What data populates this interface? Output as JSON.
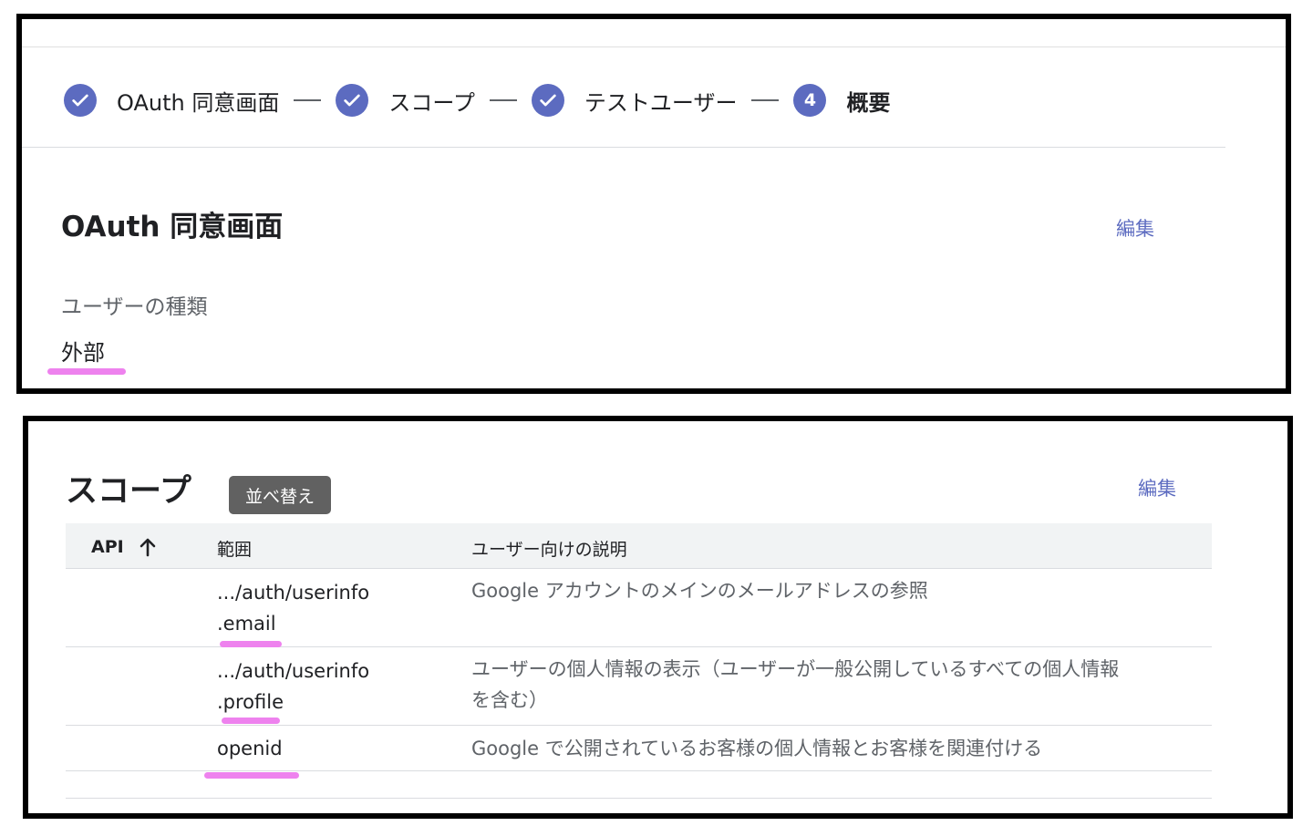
{
  "stepper": {
    "steps": [
      {
        "label": "OAuth 同意画面",
        "state": "done"
      },
      {
        "label": "スコープ",
        "state": "done"
      },
      {
        "label": "テストユーザー",
        "state": "done"
      },
      {
        "label": "概要",
        "state": "active",
        "number": "4"
      }
    ]
  },
  "oauth_section": {
    "title": "OAuth 同意画面",
    "edit_label": "編集",
    "user_type_label": "ユーザーの種類",
    "user_type_value": "外部"
  },
  "scope_section": {
    "title": "スコープ",
    "edit_label": "編集",
    "sort_tooltip": "並べ替え",
    "columns": {
      "api": "API",
      "range": "範囲",
      "description": "ユーザー向けの説明"
    },
    "rows": [
      {
        "range_lines": [
          ".../auth/userinfo",
          ".email"
        ],
        "description_lines": [
          "Google アカウントのメインのメールアドレスの参照"
        ]
      },
      {
        "range_lines": [
          ".../auth/userinfo",
          ".profile"
        ],
        "description_lines": [
          "ユーザーの個人情報の表示（ユーザーが一般公開しているすべての個人情報",
          "を含む）"
        ]
      },
      {
        "range_lines": [
          "openid"
        ],
        "description_lines": [
          "Google で公開されているお客様の個人情報とお客様を関連付ける"
        ]
      }
    ]
  },
  "colors": {
    "accent": "#5c6bc0",
    "highlight": "#ee82ee",
    "tooltip_bg": "#616161",
    "header_bg": "#f1f3f4"
  }
}
